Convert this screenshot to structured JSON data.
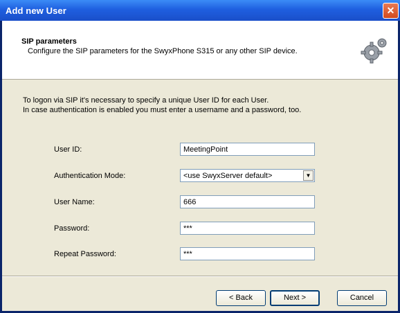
{
  "window": {
    "title": "Add new User",
    "close_icon": "close-icon"
  },
  "header": {
    "title": "SIP parameters",
    "subtitle": "Configure the SIP parameters for the SwyxPhone S315 or any other SIP device.",
    "icon": "gear-icon"
  },
  "intro": {
    "line1": "To logon via SIP it's necessary to specify a unique User ID for each User.",
    "line2": "In case authentication is enabled you must enter a username and a password, too."
  },
  "form": {
    "user_id": {
      "label": "User ID:",
      "value": "MeetingPoint"
    },
    "auth_mode": {
      "label": "Authentication Mode:",
      "value": "<use SwyxServer default>"
    },
    "user_name": {
      "label": "User Name:",
      "value": "666"
    },
    "password": {
      "label": "Password:",
      "value": "***"
    },
    "repeat_password": {
      "label": "Repeat Password:",
      "value": "***"
    }
  },
  "buttons": {
    "back": "< Back",
    "next": "Next >",
    "cancel": "Cancel"
  }
}
